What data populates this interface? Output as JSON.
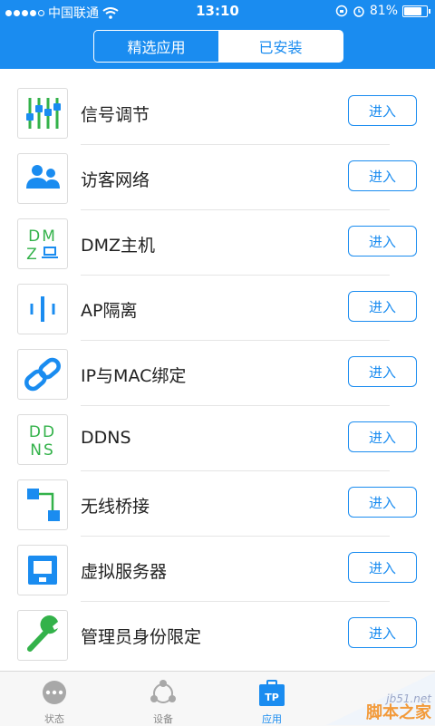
{
  "status_bar": {
    "carrier": "中国联通",
    "time": "13:10",
    "battery": "81%",
    "battery_level": 0.81
  },
  "segmented": {
    "tabs": [
      {
        "label": "精选应用",
        "active": true
      },
      {
        "label": "已安装",
        "active": false
      }
    ]
  },
  "apps": [
    {
      "name": "信号调节",
      "button": "进入",
      "icon": "signal-adjust-icon"
    },
    {
      "name": "访客网络",
      "button": "进入",
      "icon": "guest-network-icon"
    },
    {
      "name": "DMZ主机",
      "button": "进入",
      "icon": "dmz-host-icon"
    },
    {
      "name": "AP隔离",
      "button": "进入",
      "icon": "ap-isolation-icon"
    },
    {
      "name": "IP与MAC绑定",
      "button": "进入",
      "icon": "ip-mac-binding-icon"
    },
    {
      "name": "DDNS",
      "button": "进入",
      "icon": "ddns-icon"
    },
    {
      "name": "无线桥接",
      "button": "进入",
      "icon": "wireless-bridge-icon"
    },
    {
      "name": "虚拟服务器",
      "button": "进入",
      "icon": "virtual-server-icon"
    },
    {
      "name": "管理员身份限定",
      "button": "进入",
      "icon": "admin-restriction-icon"
    }
  ],
  "tabbar": [
    {
      "label": "状态",
      "icon": "status-icon",
      "active": false
    },
    {
      "label": "设备",
      "icon": "devices-icon",
      "active": false
    },
    {
      "label": "应用",
      "icon": "apps-tp-icon",
      "active": true
    }
  ],
  "watermark": {
    "line1": "jb51.net",
    "line2": "脚本之家"
  },
  "colors": {
    "accent": "#1a8cf0",
    "green": "#33b24a",
    "text": "#222222"
  }
}
